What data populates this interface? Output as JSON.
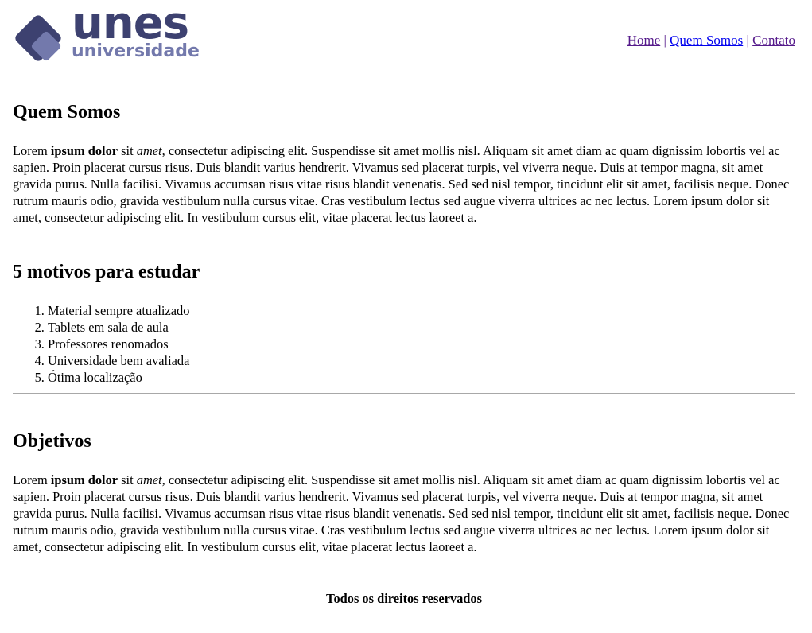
{
  "logo": {
    "main": "unes",
    "sub": "universidade",
    "colors": {
      "dark": "#3d4170",
      "light": "#7379ac"
    }
  },
  "nav": {
    "items": [
      {
        "label": "Home"
      },
      {
        "label": "Quem Somos"
      },
      {
        "label": "Contato"
      }
    ],
    "separator": "|"
  },
  "sections": {
    "quem_somos": {
      "title": "Quem Somos",
      "p_start": "Lorem ",
      "p_bold": "ipsum dolor",
      "p_mid": " sit ",
      "p_italic": "amet",
      "p_rest": ", consectetur adipiscing elit. Suspendisse sit amet mollis nisl. Aliquam sit amet diam ac quam dignissim lobortis vel ac sapien. Proin placerat cursus risus. Duis blandit varius hendrerit. Vivamus sed placerat turpis, vel viverra neque. Duis at tempor magna, sit amet gravida purus. Nulla facilisi. Vivamus accumsan risus vitae risus blandit venenatis. Sed sed nisl tempor, tincidunt elit sit amet, facilisis neque. Donec rutrum mauris odio, gravida vestibulum nulla cursus vitae. Cras vestibulum lectus sed augue viverra ultrices ac nec lectus. Lorem ipsum dolor sit amet, consectetur adipiscing elit. In vestibulum cursus elit, vitae placerat lectus laoreet a."
    },
    "motivos": {
      "title": "5 motivos para estudar",
      "items": [
        "Material sempre atualizado",
        "Tablets em sala de aula",
        "Professores renomados",
        "Universidade bem avaliada",
        "Ótima localização"
      ]
    },
    "objetivos": {
      "title": "Objetivos",
      "p_start": "Lorem ",
      "p_bold": "ipsum dolor",
      "p_mid": " sit ",
      "p_italic": "amet",
      "p_rest": ", consectetur adipiscing elit. Suspendisse sit amet mollis nisl. Aliquam sit amet diam ac quam dignissim lobortis vel ac sapien. Proin placerat cursus risus. Duis blandit varius hendrerit. Vivamus sed placerat turpis, vel viverra neque. Duis at tempor magna, sit amet gravida purus. Nulla facilisi. Vivamus accumsan risus vitae risus blandit venenatis. Sed sed nisl tempor, tincidunt elit sit amet, facilisis neque. Donec rutrum mauris odio, gravida vestibulum nulla cursus vitae. Cras vestibulum lectus sed augue viverra ultrices ac nec lectus. Lorem ipsum dolor sit amet, consectetur adipiscing elit. In vestibulum cursus elit, vitae placerat lectus laoreet a."
    }
  },
  "footer": {
    "text": "Todos os direitos reservados"
  }
}
